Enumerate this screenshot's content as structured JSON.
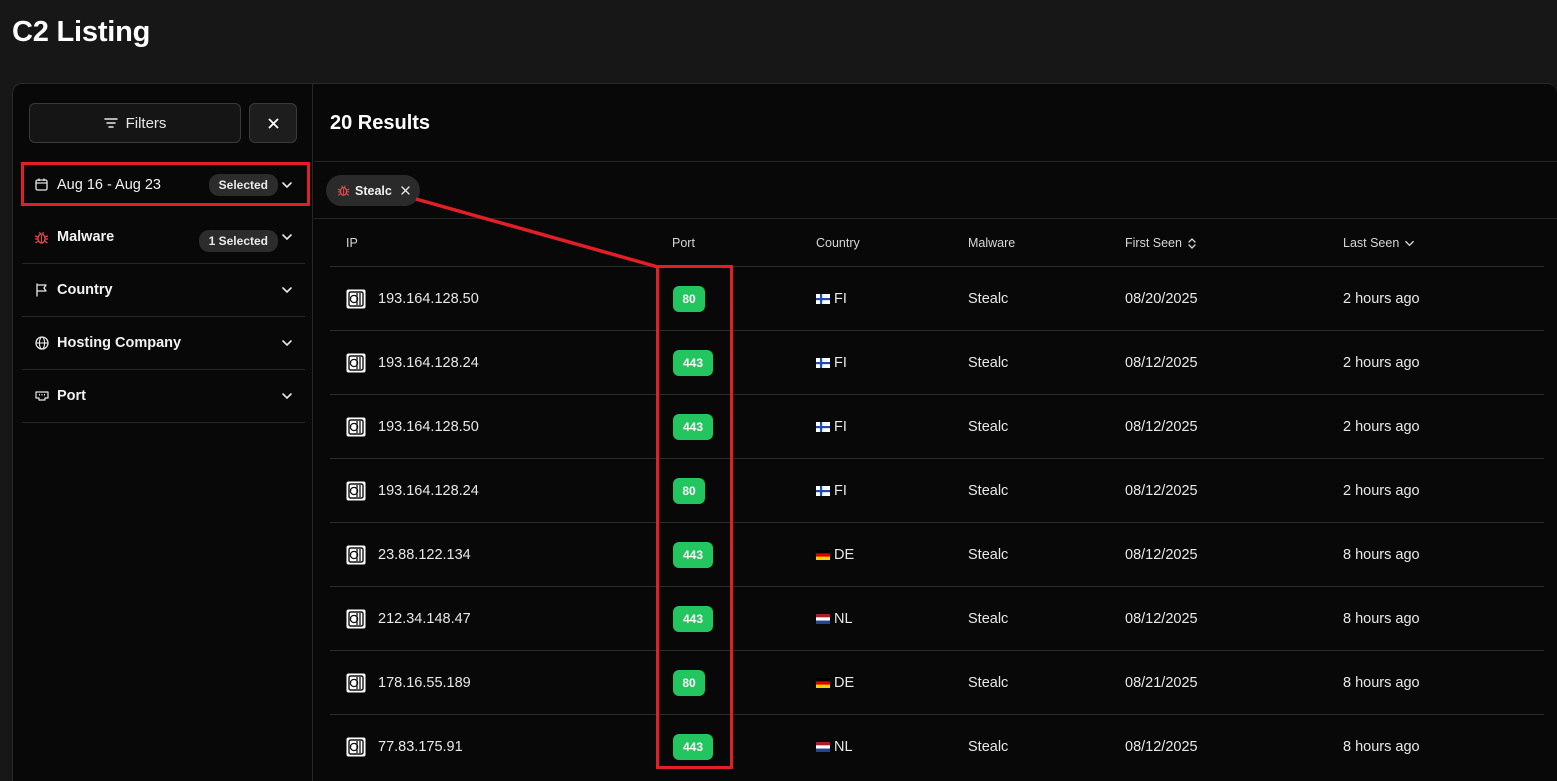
{
  "page": {
    "title": "C2 Listing"
  },
  "sidebar": {
    "filters_label": "Filters",
    "date": {
      "label": "Aug 16 - Aug 23",
      "badge": "Selected"
    },
    "groups": [
      {
        "label": "Malware",
        "badge": "1 Selected",
        "icon": "bug-icon"
      },
      {
        "label": "Country",
        "icon": "flag-icon"
      },
      {
        "label": "Hosting Company",
        "icon": "globe-icon"
      },
      {
        "label": "Port",
        "icon": "ethernet-port-icon"
      }
    ]
  },
  "results": {
    "title": "20 Results",
    "active_filter": "Stealc",
    "columns": [
      "IP",
      "Port",
      "Country",
      "Malware",
      "First Seen",
      "Last Seen"
    ],
    "rows": [
      {
        "ip": "193.164.128.50",
        "port": "80",
        "country": "FI",
        "malware": "Stealc",
        "first_seen": "08/20/2025",
        "last_seen": "2 hours ago"
      },
      {
        "ip": "193.164.128.24",
        "port": "443",
        "country": "FI",
        "malware": "Stealc",
        "first_seen": "08/12/2025",
        "last_seen": "2 hours ago"
      },
      {
        "ip": "193.164.128.50",
        "port": "443",
        "country": "FI",
        "malware": "Stealc",
        "first_seen": "08/12/2025",
        "last_seen": "2 hours ago"
      },
      {
        "ip": "193.164.128.24",
        "port": "80",
        "country": "FI",
        "malware": "Stealc",
        "first_seen": "08/12/2025",
        "last_seen": "2 hours ago"
      },
      {
        "ip": "23.88.122.134",
        "port": "443",
        "country": "DE",
        "malware": "Stealc",
        "first_seen": "08/12/2025",
        "last_seen": "8 hours ago"
      },
      {
        "ip": "212.34.148.47",
        "port": "443",
        "country": "NL",
        "malware": "Stealc",
        "first_seen": "08/12/2025",
        "last_seen": "8 hours ago"
      },
      {
        "ip": "178.16.55.189",
        "port": "80",
        "country": "DE",
        "malware": "Stealc",
        "first_seen": "08/21/2025",
        "last_seen": "8 hours ago"
      },
      {
        "ip": "77.83.175.91",
        "port": "443",
        "country": "NL",
        "malware": "Stealc",
        "first_seen": "08/12/2025",
        "last_seen": "8 hours ago"
      }
    ]
  },
  "colors": {
    "background": "#171717",
    "panel": "#080808",
    "port_badge": "#22c55e",
    "highlight": "#e21f26",
    "malware_icon": "#e5484d"
  }
}
